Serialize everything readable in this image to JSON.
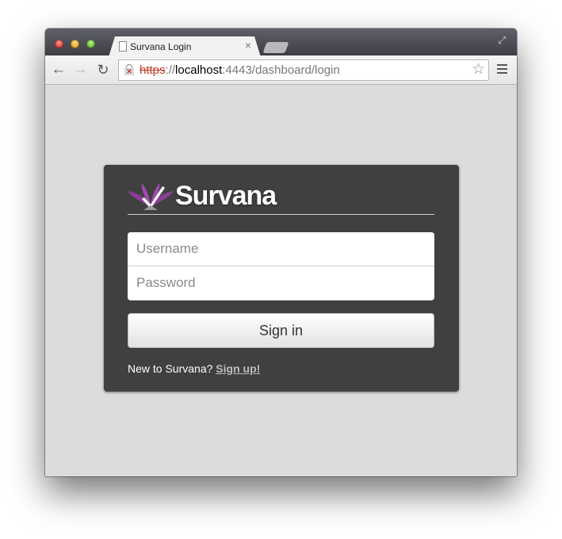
{
  "browser": {
    "tab_title": "Survana Login",
    "tab_close": "×",
    "url_scheme": "https",
    "url_separator": "://",
    "url_host": "localhost",
    "url_rest": ":4443/dashboard/login",
    "icons": {
      "back": "arrow-left-icon",
      "forward": "arrow-right-icon",
      "reload": "reload-icon",
      "bookmark": "star-icon",
      "menu": "hamburger-menu-icon",
      "security": "broken-lock-icon",
      "fullscreen": "expand-icon"
    }
  },
  "login": {
    "brand_name": "Survana",
    "username_placeholder": "Username",
    "password_placeholder": "Password",
    "signin_label": "Sign in",
    "signup_prompt": "New to Survana?",
    "signup_link": "Sign up!"
  },
  "colors": {
    "card_background": "#404040",
    "page_background": "#dcdcdc",
    "logo_purple": "#8e3c9b",
    "https_error_red": "#c0392b"
  }
}
